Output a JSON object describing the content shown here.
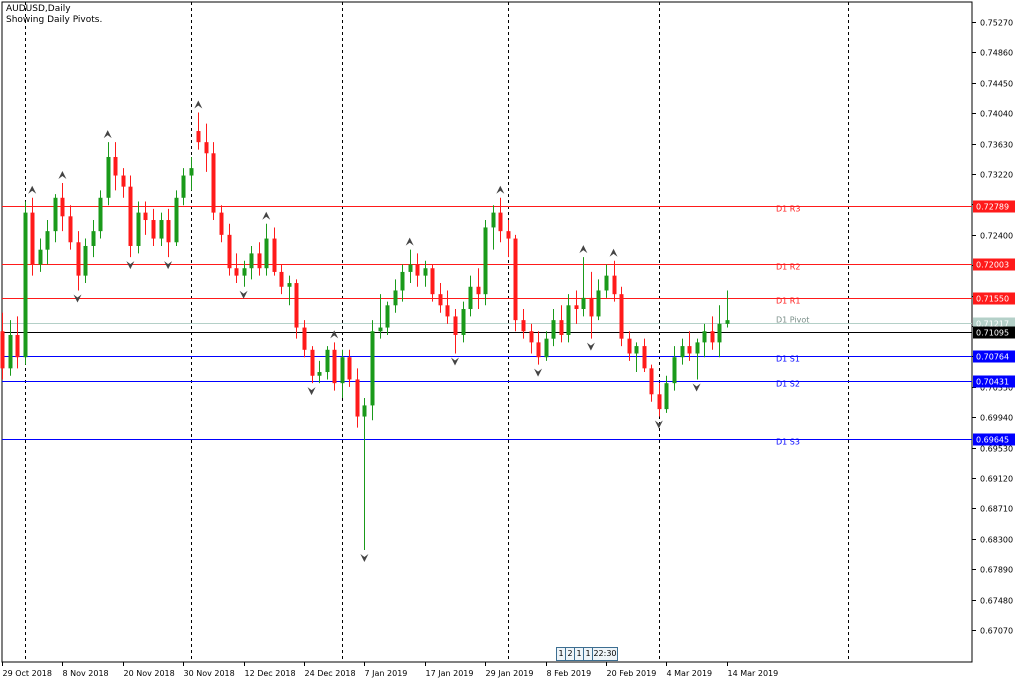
{
  "header": {
    "symbol": "AUDUSD,Daily",
    "subtitle": "Showing Daily Pivots."
  },
  "badges": {
    "b1": "1",
    "b2": "2",
    "b3": "1",
    "b4": "1",
    "time": "22:30"
  },
  "colors": {
    "bull": "#1a9a1a",
    "bear": "#ff1a1a",
    "resistance": "#ff1a1a",
    "support": "#0000ff",
    "pivot": "#b4d0c8",
    "current": "#000000"
  },
  "chart_data": {
    "type": "candlestick",
    "symbol": "AUDUSD",
    "timeframe": "Daily",
    "ylim": [
      0.6664,
      0.7554
    ],
    "y_ticks": [
      "0.75270",
      "0.74860",
      "0.74450",
      "0.74040",
      "0.73630",
      "0.73220",
      "0.72810",
      "0.72400",
      "0.71990",
      "0.71580",
      "0.71170",
      "0.70760",
      "0.70350",
      "0.69940",
      "0.69530",
      "0.69120",
      "0.68710",
      "0.68300",
      "0.67890",
      "0.67480",
      "0.67070"
    ],
    "x_labels": [
      {
        "i": 0,
        "text": "29 Oct 2018"
      },
      {
        "i": 8,
        "text": "8 Nov 2018"
      },
      {
        "i": 16,
        "text": "20 Nov 2018"
      },
      {
        "i": 24,
        "text": "30 Nov 2018"
      },
      {
        "i": 32,
        "text": "12 Dec 2018"
      },
      {
        "i": 40,
        "text": "24 Dec 2018"
      },
      {
        "i": 48,
        "text": "7 Jan 2019"
      },
      {
        "i": 56,
        "text": "17 Jan 2019"
      },
      {
        "i": 64,
        "text": "29 Jan 2019"
      },
      {
        "i": 72,
        "text": "8 Feb 2019"
      },
      {
        "i": 80,
        "text": "20 Feb 2019"
      },
      {
        "i": 88,
        "text": "4 Mar 2019"
      },
      {
        "i": 96,
        "text": "14 Mar 2019"
      }
    ],
    "separators": [
      3,
      25,
      45,
      67,
      87,
      112
    ],
    "pivots": [
      {
        "name": "D1 R3",
        "value": 0.72789,
        "label": "0.72789",
        "kind": "resistance"
      },
      {
        "name": "D1 R2",
        "value": 0.72003,
        "label": "0.72003",
        "kind": "resistance"
      },
      {
        "name": "D1 R1",
        "value": 0.7155,
        "label": "0.71550",
        "kind": "resistance"
      },
      {
        "name": "D1 Pivot",
        "value": 0.71217,
        "label": "0.71217",
        "kind": "pivot"
      },
      {
        "name": "D1 S1",
        "value": 0.70764,
        "label": "0.70764",
        "kind": "support"
      },
      {
        "name": "D1 S2",
        "value": 0.70431,
        "label": "0.70431",
        "kind": "support"
      },
      {
        "name": "D1 S3",
        "value": 0.69645,
        "label": "0.69645",
        "kind": "support"
      }
    ],
    "current_price": {
      "value": 0.71095,
      "label": "0.71095"
    },
    "candles": [
      [
        0.711,
        0.7135,
        0.7045,
        0.706
      ],
      [
        0.706,
        0.7125,
        0.705,
        0.7105
      ],
      [
        0.7105,
        0.713,
        0.706,
        0.7075
      ],
      [
        0.7075,
        0.7285,
        0.7065,
        0.727
      ],
      [
        0.727,
        0.729,
        0.7185,
        0.72
      ],
      [
        0.72,
        0.7235,
        0.719,
        0.722
      ],
      [
        0.722,
        0.726,
        0.72,
        0.7245
      ],
      [
        0.7245,
        0.7295,
        0.723,
        0.729
      ],
      [
        0.729,
        0.731,
        0.7245,
        0.7265
      ],
      [
        0.7265,
        0.728,
        0.722,
        0.723
      ],
      [
        0.723,
        0.7245,
        0.7165,
        0.7185
      ],
      [
        0.7185,
        0.7235,
        0.7175,
        0.7225
      ],
      [
        0.7225,
        0.726,
        0.721,
        0.7245
      ],
      [
        0.7245,
        0.73,
        0.7235,
        0.729
      ],
      [
        0.729,
        0.7365,
        0.728,
        0.7345
      ],
      [
        0.7345,
        0.7365,
        0.73,
        0.732
      ],
      [
        0.732,
        0.733,
        0.729,
        0.7305
      ],
      [
        0.7305,
        0.732,
        0.721,
        0.7225
      ],
      [
        0.7225,
        0.7285,
        0.7215,
        0.727
      ],
      [
        0.727,
        0.7285,
        0.724,
        0.726
      ],
      [
        0.726,
        0.7275,
        0.7225,
        0.7235
      ],
      [
        0.7235,
        0.727,
        0.7225,
        0.726
      ],
      [
        0.726,
        0.7275,
        0.721,
        0.723
      ],
      [
        0.723,
        0.73,
        0.7225,
        0.729
      ],
      [
        0.729,
        0.733,
        0.728,
        0.732
      ],
      [
        0.732,
        0.7345,
        0.73,
        0.733
      ],
      [
        0.738,
        0.7405,
        0.7355,
        0.7365
      ],
      [
        0.7365,
        0.739,
        0.7325,
        0.735
      ],
      [
        0.735,
        0.7365,
        0.726,
        0.727
      ],
      [
        0.727,
        0.728,
        0.723,
        0.724
      ],
      [
        0.724,
        0.7255,
        0.7185,
        0.7195
      ],
      [
        0.7195,
        0.7215,
        0.7175,
        0.7185
      ],
      [
        0.7185,
        0.7205,
        0.717,
        0.7195
      ],
      [
        0.7195,
        0.7225,
        0.718,
        0.7215
      ],
      [
        0.7215,
        0.723,
        0.7185,
        0.7195
      ],
      [
        0.7195,
        0.7255,
        0.7185,
        0.7235
      ],
      [
        0.7235,
        0.725,
        0.7185,
        0.719
      ],
      [
        0.719,
        0.72,
        0.716,
        0.717
      ],
      [
        0.717,
        0.7185,
        0.7145,
        0.7175
      ],
      [
        0.7175,
        0.718,
        0.71,
        0.7115
      ],
      [
        0.7115,
        0.7125,
        0.7075,
        0.7085
      ],
      [
        0.7085,
        0.709,
        0.704,
        0.705
      ],
      [
        0.705,
        0.707,
        0.704,
        0.7055
      ],
      [
        0.7055,
        0.709,
        0.7045,
        0.7085
      ],
      [
        0.7085,
        0.7095,
        0.703,
        0.704
      ],
      [
        0.704,
        0.7085,
        0.702,
        0.7075
      ],
      [
        0.7075,
        0.7085,
        0.7035,
        0.7045
      ],
      [
        0.7045,
        0.706,
        0.698,
        0.6995
      ],
      [
        0.6995,
        0.702,
        0.6815,
        0.701
      ],
      [
        0.701,
        0.7125,
        0.699,
        0.711
      ],
      [
        0.711,
        0.716,
        0.71,
        0.7115
      ],
      [
        0.7115,
        0.715,
        0.7105,
        0.7145
      ],
      [
        0.7145,
        0.718,
        0.7135,
        0.7165
      ],
      [
        0.7165,
        0.72,
        0.715,
        0.719
      ],
      [
        0.719,
        0.722,
        0.7175,
        0.72
      ],
      [
        0.72,
        0.7215,
        0.717,
        0.7185
      ],
      [
        0.7185,
        0.7205,
        0.717,
        0.7195
      ],
      [
        0.7195,
        0.72,
        0.715,
        0.716
      ],
      [
        0.716,
        0.7175,
        0.7135,
        0.7145
      ],
      [
        0.7145,
        0.7165,
        0.712,
        0.713
      ],
      [
        0.713,
        0.714,
        0.708,
        0.7105
      ],
      [
        0.7105,
        0.715,
        0.7095,
        0.714
      ],
      [
        0.714,
        0.7185,
        0.713,
        0.717
      ],
      [
        0.717,
        0.7195,
        0.714,
        0.716
      ],
      [
        0.716,
        0.726,
        0.7145,
        0.725
      ],
      [
        0.725,
        0.728,
        0.722,
        0.727
      ],
      [
        0.727,
        0.729,
        0.723,
        0.7245
      ],
      [
        0.7245,
        0.726,
        0.721,
        0.7235
      ],
      [
        0.7235,
        0.724,
        0.711,
        0.7125
      ],
      [
        0.7125,
        0.714,
        0.71,
        0.711
      ],
      [
        0.711,
        0.712,
        0.708,
        0.7095
      ],
      [
        0.7095,
        0.711,
        0.7065,
        0.7075
      ],
      [
        0.7075,
        0.711,
        0.707,
        0.71
      ],
      [
        0.71,
        0.714,
        0.709,
        0.7125
      ],
      [
        0.7125,
        0.7145,
        0.7095,
        0.7105
      ],
      [
        0.7105,
        0.716,
        0.7095,
        0.7145
      ],
      [
        0.7145,
        0.7165,
        0.712,
        0.714
      ],
      [
        0.714,
        0.721,
        0.713,
        0.7155
      ],
      [
        0.7155,
        0.719,
        0.71,
        0.713
      ],
      [
        0.713,
        0.718,
        0.7125,
        0.7165
      ],
      [
        0.7165,
        0.72,
        0.7155,
        0.7185
      ],
      [
        0.7185,
        0.7205,
        0.715,
        0.716
      ],
      [
        0.716,
        0.717,
        0.709,
        0.71
      ],
      [
        0.71,
        0.711,
        0.707,
        0.708
      ],
      [
        0.708,
        0.7095,
        0.7055,
        0.709
      ],
      [
        0.709,
        0.71,
        0.7055,
        0.706
      ],
      [
        0.706,
        0.7065,
        0.7015,
        0.7025
      ],
      [
        0.7025,
        0.704,
        0.6995,
        0.7005
      ],
      [
        0.7005,
        0.705,
        0.7,
        0.704
      ],
      [
        0.704,
        0.709,
        0.703,
        0.7075
      ],
      [
        0.7075,
        0.71,
        0.7065,
        0.709
      ],
      [
        0.709,
        0.711,
        0.707,
        0.708
      ],
      [
        0.708,
        0.71,
        0.7045,
        0.7095
      ],
      [
        0.7095,
        0.712,
        0.7075,
        0.711
      ],
      [
        0.711,
        0.713,
        0.7085,
        0.7095
      ],
      [
        0.7095,
        0.7145,
        0.7075,
        0.712
      ],
      [
        0.712,
        0.7165,
        0.7115,
        0.7125
      ]
    ]
  }
}
